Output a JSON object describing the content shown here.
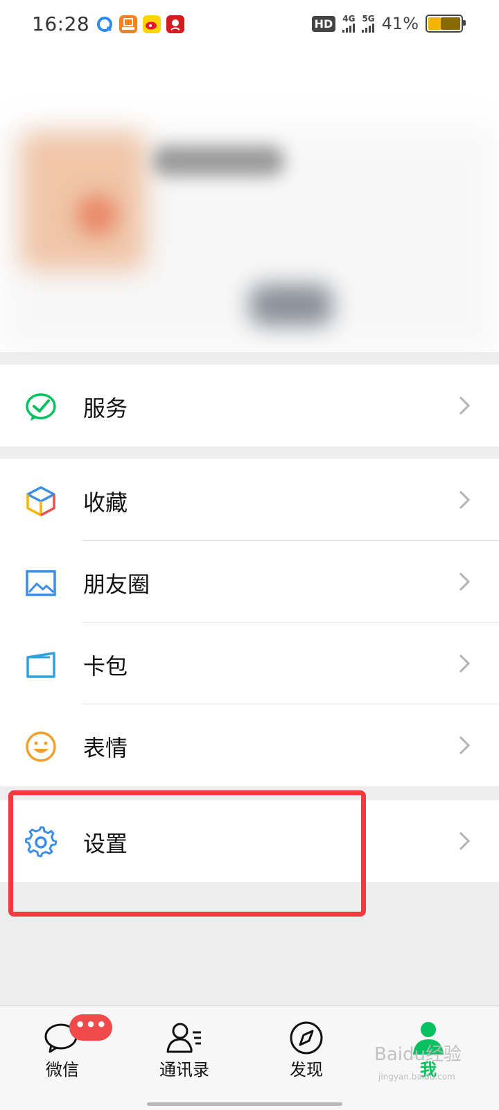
{
  "status_bar": {
    "time": "16:28",
    "hd": "HD",
    "net1": "4G",
    "net2": "5G",
    "battery": "41%"
  },
  "menu": {
    "services": "服务",
    "favorites": "收藏",
    "moments": "朋友圈",
    "cards": "卡包",
    "stickers": "表情",
    "settings": "设置"
  },
  "tabs": {
    "chats": "微信",
    "chats_badge": "•••",
    "contacts": "通讯录",
    "discover": "发现",
    "me": "我"
  },
  "watermark": {
    "brand": "Baidu经验",
    "site": "jingyan.baidu.com"
  },
  "colors": {
    "accent": "#07c160",
    "highlight": "#f23b41",
    "badge": "#f04a4a"
  }
}
